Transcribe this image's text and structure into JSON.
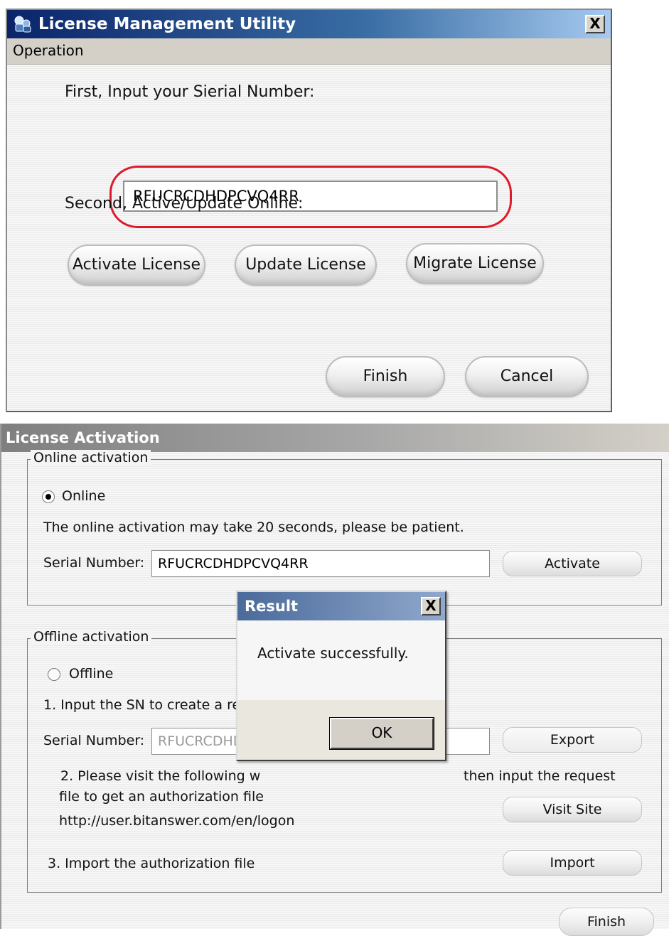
{
  "license_utility": {
    "title": "License Management Utility",
    "close_glyph": "X",
    "menu": {
      "operation": "Operation"
    },
    "first_label": "First, Input your Sierial Number:",
    "serial_value": "RFUCRCDHDPCVQ4RR",
    "second_label": "Second, Active/Update Online:",
    "buttons": {
      "activate": "Activate License",
      "update": "Update License",
      "migrate": "Migrate License",
      "finish": "Finish",
      "cancel": "Cancel"
    },
    "highlight_color": "#dd1a2a"
  },
  "license_activation": {
    "title": "License Activation",
    "online": {
      "legend": "Online activation",
      "radio_label": "Online",
      "note": "The online activation may take 20 seconds, please be patient.",
      "serial_label": "Serial Number:",
      "serial_value": "RFUCRCDHDPCVQ4RR",
      "activate_button": "Activate"
    },
    "offline": {
      "legend": "Offline activation",
      "radio_label": "Offline",
      "step1": "1. Input the SN to create a re",
      "serial_label": "Serial Number:",
      "serial_value": "RFUCRCDHD",
      "export_button": "Export",
      "step2_a": "2. Please visit the following w",
      "step2_b": "then input the request",
      "step2_c": "file to get an authorization file",
      "url": "http://user.bitanswer.com/en/logon",
      "visit_button": "Visit Site",
      "step3": "3. Import the authorization file",
      "import_button": "Import"
    },
    "finish_button": "Finish"
  },
  "result_dialog": {
    "title": "Result",
    "close_glyph": "X",
    "message": "Activate successfully.",
    "ok_button": "OK"
  }
}
